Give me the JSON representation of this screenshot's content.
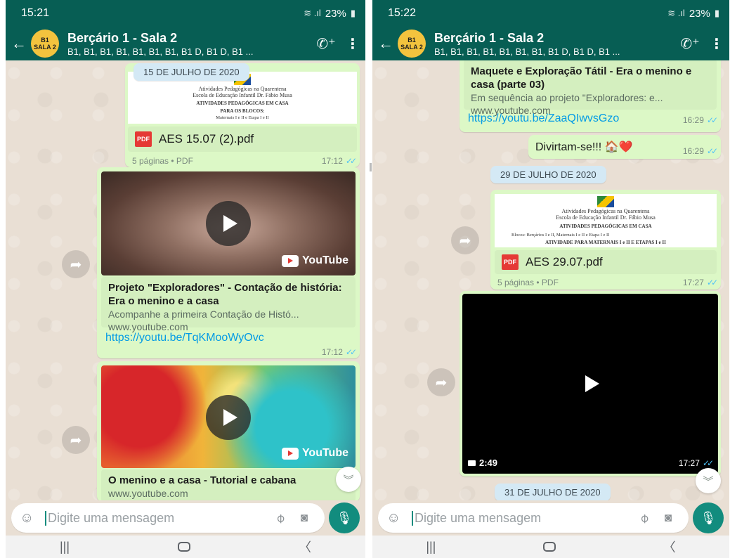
{
  "left": {
    "status": {
      "time": "15:21",
      "battery": "23%"
    },
    "header": {
      "avatar_line1": "B1",
      "avatar_line2": "SALA 2",
      "title": "Berçário 1 - Sala 2",
      "subtitle": "B1, B1, B1, B1, B1, B1, B1, B1 D, B1 D, B1 ..."
    },
    "date_chip": "15 DE JULHO DE 2020",
    "doc1": {
      "preview_lines": [
        "Atividades Pedagógicas na Quarentena",
        "Escola de Educação Infantil Dr. Fábio Musa",
        "ATIVIDADES PEDAGÓGICAS EM CASA",
        "PARA OS BLOCOS:",
        "Maternais I e II e Etapa I e II"
      ],
      "name": "AES 15.07 (2).pdf",
      "meta": "5 páginas • PDF",
      "time": "17:12"
    },
    "video1": {
      "yt_label": "YouTube",
      "title": "Projeto \"Exploradores\" - Contação de história: Era o menino e a casa",
      "desc": "Acompanhe a primeira Contação de Histó...",
      "domain": "www.youtube.com",
      "url": "https://youtu.be/TqKMooWyOvc",
      "time": "17:12"
    },
    "video2": {
      "yt_label": "YouTube",
      "title": "O menino e a casa - Tutorial e cabana",
      "domain": "www.youtube.com"
    },
    "composer": {
      "placeholder": "Digite uma mensagem"
    }
  },
  "right": {
    "status": {
      "time": "15:22",
      "battery": "23%"
    },
    "header": {
      "avatar_line1": "B1",
      "avatar_line2": "SALA 2",
      "title": "Berçário 1 - Sala 2",
      "subtitle": "B1, B1, B1, B1, B1, B1, B1, B1 D, B1 D, B1 ..."
    },
    "link_top": {
      "title": "Maquete e Exploração Tátil - Era o menino e casa (parte 03)",
      "desc": "Em sequência ao projeto \"Exploradores: e...",
      "domain": "www.youtube.com",
      "url": "https://youtu.be/ZaaQIwvsGzo",
      "time": "16:29"
    },
    "msg_fun": {
      "text": "Divirtam-se!!! 🏠❤️",
      "time": "16:29"
    },
    "date_chip_1": "29 DE JULHO DE 2020",
    "doc2": {
      "preview_lines": [
        "Atividades Pedagógicas na Quarentena",
        "Escola de Educação Infantil Dr. Fábio Musa",
        "ATIVIDADES PEDAGÓGICAS EM CASA",
        "Blocos: Berçários I e II, Maternais I e II e Etapa I e II",
        "ATIVIDADE PARA MATERNAIS I e II E ETAPAS I e II"
      ],
      "name": "AES 29.07.pdf",
      "meta": "5 páginas • PDF",
      "time": "17:27"
    },
    "video3": {
      "duration": "2:49",
      "time": "17:27"
    },
    "date_chip_2": "31 DE JULHO DE 2020",
    "composer": {
      "placeholder": "Digite uma mensagem"
    }
  },
  "colors": {
    "header_green": "#075e54",
    "bubble_green": "#dcf8c6",
    "accent_teal": "#128c7e",
    "link_blue": "#039be5",
    "tick_blue": "#4fc3f7"
  }
}
